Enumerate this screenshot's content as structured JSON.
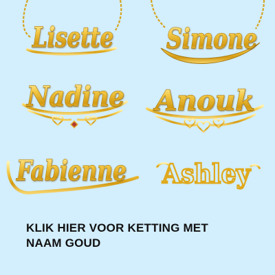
{
  "colors": {
    "background": "#d3eefd",
    "gold": "#e0a91c",
    "text": "#111111"
  },
  "necklaces": [
    {
      "name": "Lisette"
    },
    {
      "name": "Simone"
    },
    {
      "name": "Nadine"
    },
    {
      "name": "Anouk"
    },
    {
      "name": "Fabienne"
    },
    {
      "name": "Ashley"
    }
  ],
  "caption": {
    "line1": "KLIK HIER VOOR KETTING MET",
    "line2": "NAAM GOUD"
  }
}
